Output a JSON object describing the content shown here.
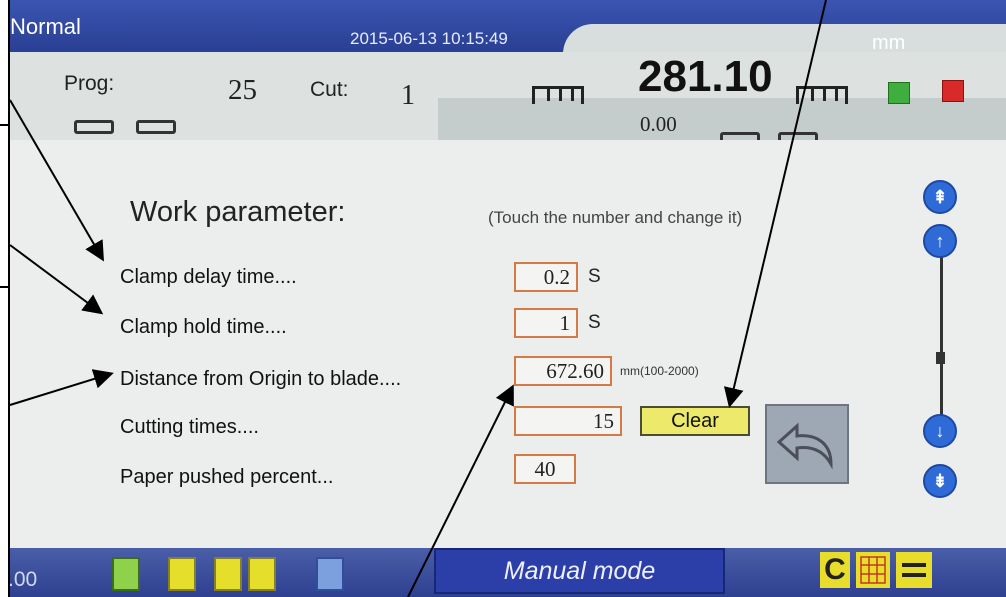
{
  "status_bar": {
    "mode": "Normal",
    "datetime": "2015-06-13  10:15:49",
    "unit": "mm"
  },
  "info": {
    "prog_label": "Prog:",
    "prog_value": "25",
    "cut_label": "Cut:",
    "cut_value": "1",
    "position": "281.10",
    "offset": "0.00"
  },
  "work": {
    "title": "Work parameter:",
    "hint": "(Touch the number and change it)",
    "params": [
      {
        "label": "Clamp delay time....",
        "value": "0.2",
        "unit": "S"
      },
      {
        "label": "Clamp hold time....",
        "value": "1",
        "unit": "S"
      },
      {
        "label": "Distance from Origin to blade....",
        "value": "672.60",
        "unit": "mm(100-2000)"
      },
      {
        "label": "Cutting times....",
        "value": "15"
      },
      {
        "label": "Paper pushed percent...",
        "value": "40"
      }
    ],
    "clear_label": "Clear"
  },
  "bottom": {
    "left_readout": ".00",
    "mode_label": "Manual mode",
    "c_label": "C"
  },
  "colors": {
    "header_blue": "#2a3f93",
    "field_border": "#d47a45",
    "button_yellow": "#ede96a",
    "scroll_blue": "#2f6bd6",
    "icon_green": "#3fae3f",
    "icon_red": "#d92a2a"
  },
  "icons": [
    "ruler-icon",
    "clamp-icon",
    "green-square-icon",
    "red-trash-icon",
    "back-arrow-icon",
    "page-up-icon",
    "line-up-icon",
    "line-down-icon",
    "page-down-icon",
    "book-icon",
    "grid-icon",
    "equals-icon"
  ]
}
